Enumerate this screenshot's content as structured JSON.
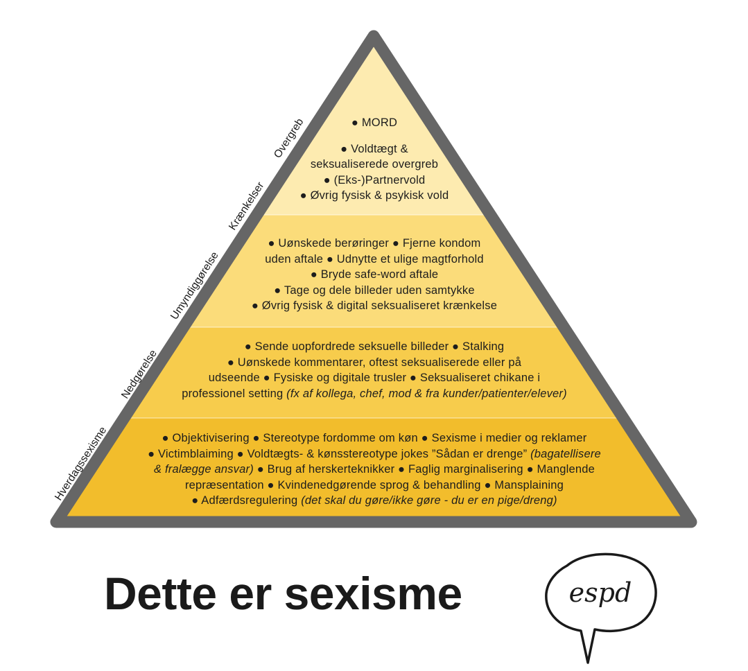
{
  "colors": {
    "frame": "#666666",
    "tier1": "#fdebb0",
    "tier2": "#fbdc7a",
    "tier3": "#f7cc4c",
    "tier4": "#f2bd2c",
    "text": "#1d1d1d"
  },
  "side_labels": [
    "Overgreb",
    "Krænkelser",
    "Umyndiggørelse",
    "Nedgørelse",
    "Hverdagssexisme"
  ],
  "tiers": [
    {
      "lines": [
        [
          {
            "t": "● MORD"
          }
        ],
        [
          {
            "t": ""
          }
        ],
        [
          {
            "t": "● Voldtægt &"
          }
        ],
        [
          {
            "t": "seksualiserede overgreb"
          }
        ],
        [
          {
            "t": "● (Eks-)Partnervold"
          }
        ],
        [
          {
            "t": "● Øvrig fysisk & psykisk vold"
          }
        ]
      ]
    },
    {
      "lines": [
        [
          {
            "t": "● Uønskede berøringer ● Fjerne kondom"
          }
        ],
        [
          {
            "t": "uden aftale  ● Udnytte et ulige magtforhold"
          }
        ],
        [
          {
            "t": "● Bryde safe-word aftale"
          }
        ],
        [
          {
            "t": "● Tage og dele billeder uden samtykke"
          }
        ],
        [
          {
            "t": "● Øvrig fysisk & digital seksualiseret krænkelse"
          }
        ]
      ]
    },
    {
      "lines": [
        [
          {
            "t": "● Sende uopfordrede seksuelle billeder ● Stalking"
          }
        ],
        [
          {
            "t": "● Uønskede kommentarer, oftest seksualiserede eller på"
          }
        ],
        [
          {
            "t": "udseende ● Fysiske og digitale trusler ● Seksualiseret chikane i"
          }
        ],
        [
          {
            "t": "professionel setting "
          },
          {
            "t": "(fx af kollega, chef, mod & fra kunder/patienter/elever)",
            "i": true
          }
        ]
      ]
    },
    {
      "lines": [
        [
          {
            "t": "● Objektivisering ● Stereotype fordomme om køn ● Sexisme i medier og reklamer"
          }
        ],
        [
          {
            "t": "● Victimblaiming ● Voldtægts- & kønsstereotype jokes ”Sådan er drenge” "
          },
          {
            "t": "(bagatellisere",
            "i": true
          }
        ],
        [
          {
            "t": "& fralægge ansvar)",
            "i": true
          },
          {
            "t": " ● Brug af herskerteknikker ● Faglig marginalisering ● Manglende"
          }
        ],
        [
          {
            "t": "repræsentation ● Kvindenedgørende sprog & behandling ● Mansplaining"
          }
        ],
        [
          {
            "t": "● Adfærdsregulering "
          },
          {
            "t": "(det skal du gøre/ikke gøre - du er en pige/dreng)",
            "i": true
          }
        ]
      ]
    }
  ],
  "title": "Dette er sexisme",
  "logo_text": "espd"
}
